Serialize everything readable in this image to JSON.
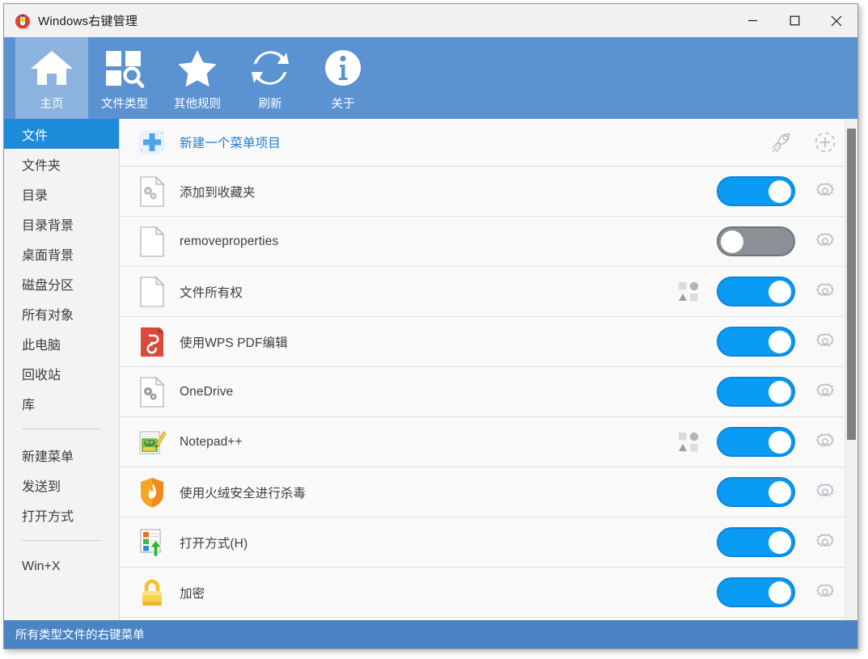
{
  "window": {
    "title": "Windows右键管理",
    "app_icon": "mouse-icon",
    "controls": {
      "minimize": "minimize-icon",
      "maximize": "maximize-icon",
      "close": "close-icon"
    }
  },
  "toolbar": {
    "items": [
      {
        "label": "主页",
        "icon": "home-icon",
        "active": true
      },
      {
        "label": "文件类型",
        "icon": "file-type-icon",
        "active": false
      },
      {
        "label": "其他规则",
        "icon": "star-icon",
        "active": false
      },
      {
        "label": "刷新",
        "icon": "refresh-icon",
        "active": false
      },
      {
        "label": "关于",
        "icon": "info-icon",
        "active": false
      }
    ]
  },
  "sidebar": {
    "groups": [
      {
        "items": [
          {
            "label": "文件",
            "selected": true
          },
          {
            "label": "文件夹",
            "selected": false
          },
          {
            "label": "目录",
            "selected": false
          },
          {
            "label": "目录背景",
            "selected": false
          },
          {
            "label": "桌面背景",
            "selected": false
          },
          {
            "label": "磁盘分区",
            "selected": false
          },
          {
            "label": "所有对象",
            "selected": false
          },
          {
            "label": "此电脑",
            "selected": false
          },
          {
            "label": "回收站",
            "selected": false
          },
          {
            "label": "库",
            "selected": false
          }
        ]
      },
      {
        "items": [
          {
            "label": "新建菜单",
            "selected": false
          },
          {
            "label": "发送到",
            "selected": false
          },
          {
            "label": "打开方式",
            "selected": false
          }
        ]
      },
      {
        "items": [
          {
            "label": "Win+X",
            "selected": false
          }
        ]
      }
    ]
  },
  "list": {
    "header_row": {
      "label": "新建一个菜单项目",
      "icon": "plus-add-icon",
      "actions": [
        {
          "name": "rocket-icon"
        },
        {
          "name": "add-target-icon"
        }
      ]
    },
    "rows": [
      {
        "label": "添加到收藏夹",
        "icon": "doc-gears-icon",
        "enabled": true,
        "has_shapes": false
      },
      {
        "label": "removeproperties",
        "icon": "doc-blank-icon",
        "enabled": false,
        "has_shapes": false
      },
      {
        "label": "文件所有权",
        "icon": "doc-blank-icon",
        "enabled": true,
        "has_shapes": true
      },
      {
        "label": "使用WPS PDF编辑",
        "icon": "wps-pdf-icon",
        "enabled": true,
        "has_shapes": false
      },
      {
        "label": "OneDrive",
        "icon": "doc-gears-icon",
        "enabled": true,
        "has_shapes": false
      },
      {
        "label": "Notepad++",
        "icon": "notepad-plus-icon",
        "enabled": true,
        "has_shapes": true
      },
      {
        "label": "使用火绒安全进行杀毒",
        "icon": "huorong-shield-icon",
        "enabled": true,
        "has_shapes": false
      },
      {
        "label": "打开方式(H)",
        "icon": "open-with-icon",
        "enabled": true,
        "has_shapes": false
      },
      {
        "label": "加密",
        "icon": "lock-icon",
        "enabled": true,
        "has_shapes": false
      }
    ],
    "row_gear_icon": "gear-icon",
    "scrollbar": {
      "thumb_top_pct": 2,
      "thumb_height_pct": 62
    }
  },
  "footer": {
    "status": "所有类型文件的右键菜单"
  },
  "colors": {
    "ribbon": "#5b92d1",
    "ribbon_active": "#8cb3de",
    "sidebar_selected": "#1e8bda",
    "footer": "#4a84c4",
    "toggle_on": "#0a9bf5",
    "toggle_off": "#8b9097",
    "link_blue": "#1e7fd4"
  }
}
